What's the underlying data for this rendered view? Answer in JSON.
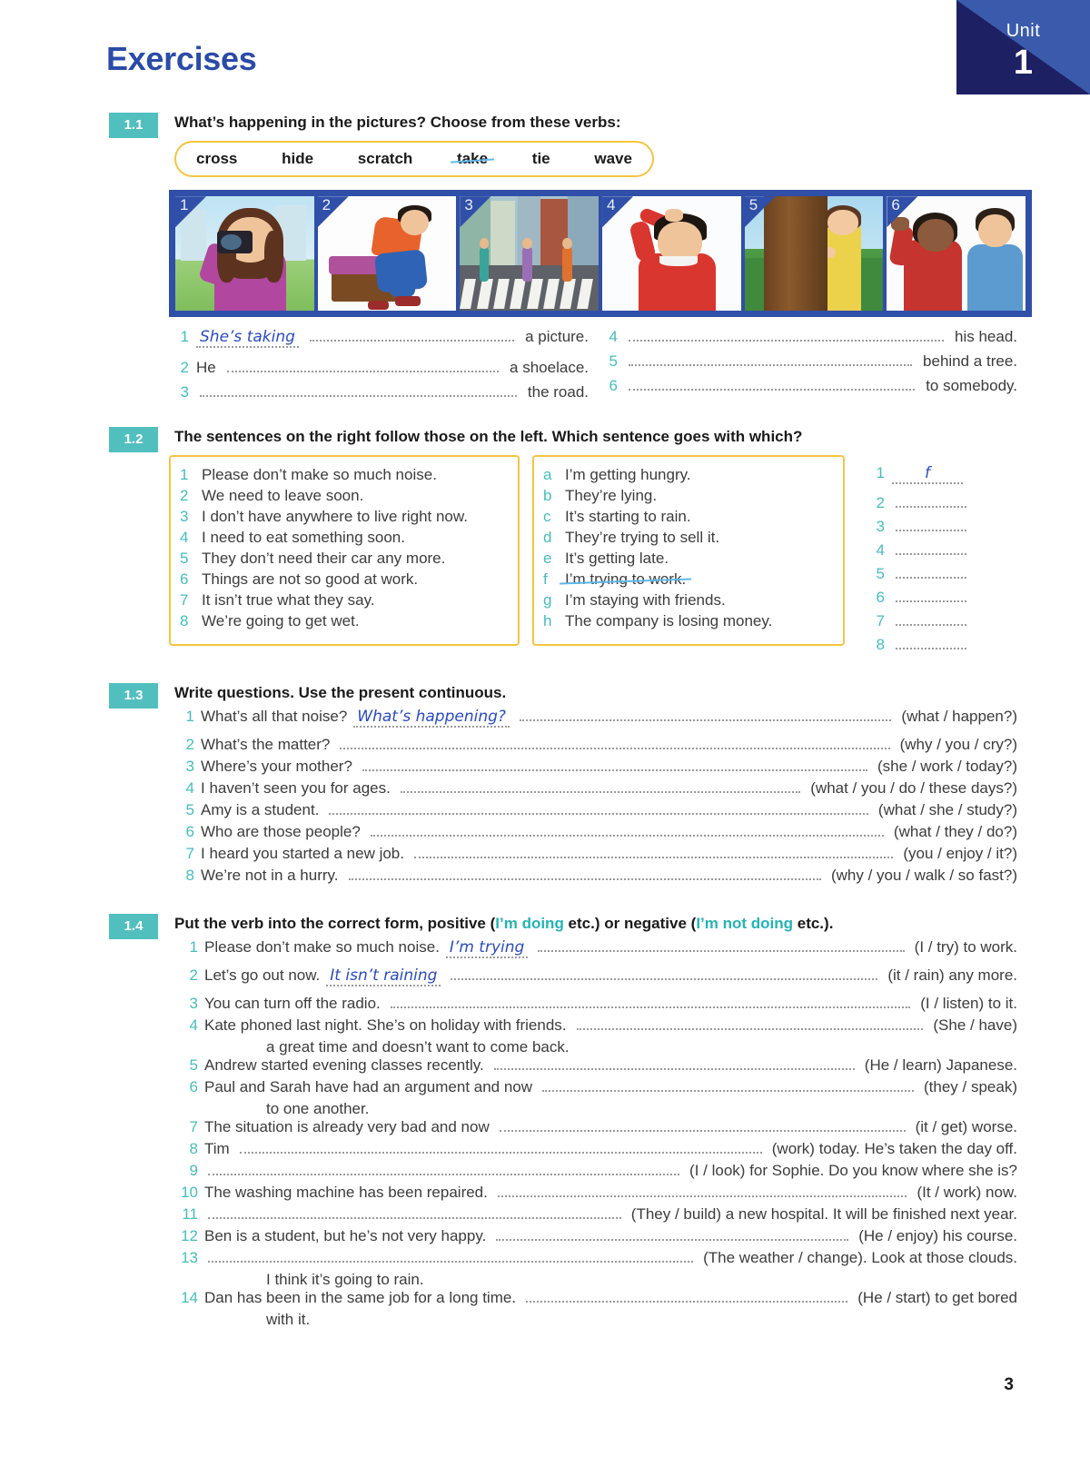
{
  "unit": {
    "label": "Unit",
    "number": "1"
  },
  "page_title": "Exercises",
  "page_number": "3",
  "ex11": {
    "number": "1.1",
    "heading": "What’s happening in the pictures?  Choose from these verbs:",
    "verbs": [
      "cross",
      "hide",
      "scratch",
      "take",
      "tie",
      "wave"
    ],
    "struck_verb": "take",
    "pictures": [
      {
        "num": "1",
        "desc": "woman-taking-photo"
      },
      {
        "num": "2",
        "desc": "man-tying-shoelace"
      },
      {
        "num": "3",
        "desc": "people-crossing-road"
      },
      {
        "num": "4",
        "desc": "man-scratching-head"
      },
      {
        "num": "5",
        "desc": "girl-hiding-behind-tree"
      },
      {
        "num": "6",
        "desc": "woman-waving"
      }
    ],
    "answers_left": [
      {
        "n": "1",
        "before": "",
        "answer": "She’s taking",
        "after": "a picture."
      },
      {
        "n": "2",
        "before": "He",
        "answer": "",
        "after": "a shoelace."
      },
      {
        "n": "3",
        "before": "",
        "answer": "",
        "after": "the road."
      }
    ],
    "answers_right": [
      {
        "n": "4",
        "before": "",
        "answer": "",
        "after": "his head."
      },
      {
        "n": "5",
        "before": "",
        "answer": "",
        "after": "behind a tree."
      },
      {
        "n": "6",
        "before": "",
        "answer": "",
        "after": "to somebody."
      }
    ]
  },
  "ex12": {
    "number": "1.2",
    "heading": "The sentences on the right follow those on the left.  Which sentence goes with which?",
    "left": [
      {
        "n": "1",
        "text": "Please don’t make so much noise."
      },
      {
        "n": "2",
        "text": "We need to leave soon."
      },
      {
        "n": "3",
        "text": "I don’t have anywhere to live right now."
      },
      {
        "n": "4",
        "text": "I need to eat something soon."
      },
      {
        "n": "5",
        "text": "They don’t need their car any more."
      },
      {
        "n": "6",
        "text": "Things are not so good at work."
      },
      {
        "n": "7",
        "text": "It isn’t true what they say."
      },
      {
        "n": "8",
        "text": "We’re going to get wet."
      }
    ],
    "right": [
      {
        "n": "a",
        "text": "I’m getting hungry.",
        "struck": false
      },
      {
        "n": "b",
        "text": "They’re lying.",
        "struck": false
      },
      {
        "n": "c",
        "text": "It’s starting to rain.",
        "struck": false
      },
      {
        "n": "d",
        "text": "They’re trying to sell it.",
        "struck": false
      },
      {
        "n": "e",
        "text": "It’s getting late.",
        "struck": false
      },
      {
        "n": "f",
        "text": "I’m trying to work.",
        "struck": true
      },
      {
        "n": "g",
        "text": "I’m staying with friends.",
        "struck": false
      },
      {
        "n": "h",
        "text": "The company is losing money.",
        "struck": false
      }
    ],
    "answers": [
      {
        "n": "1",
        "answer": "f"
      },
      {
        "n": "2",
        "answer": ""
      },
      {
        "n": "3",
        "answer": ""
      },
      {
        "n": "4",
        "answer": ""
      },
      {
        "n": "5",
        "answer": ""
      },
      {
        "n": "6",
        "answer": ""
      },
      {
        "n": "7",
        "answer": ""
      },
      {
        "n": "8",
        "answer": ""
      }
    ]
  },
  "ex13": {
    "number": "1.3",
    "heading": "Write questions.  Use the present continuous.",
    "items": [
      {
        "n": "1",
        "prompt": "What’s all that noise?",
        "answer": "What’s happening?",
        "cue": "(what / happen?)"
      },
      {
        "n": "2",
        "prompt": "What’s the matter?",
        "answer": "",
        "cue": "(why / you / cry?)"
      },
      {
        "n": "3",
        "prompt": "Where’s your mother?",
        "answer": "",
        "cue": "(she / work / today?)"
      },
      {
        "n": "4",
        "prompt": "I haven’t seen you for ages.",
        "answer": "",
        "cue": "(what / you / do / these days?)"
      },
      {
        "n": "5",
        "prompt": "Amy is a student.",
        "answer": "",
        "cue": "(what / she / study?)"
      },
      {
        "n": "6",
        "prompt": "Who are those people?",
        "answer": "",
        "cue": "(what / they / do?)"
      },
      {
        "n": "7",
        "prompt": "I heard you started a new job.",
        "answer": "",
        "cue": "(you / enjoy / it?)"
      },
      {
        "n": "8",
        "prompt": "We’re not in a hurry.",
        "answer": "",
        "cue": "(why / you / walk / so fast?)"
      }
    ]
  },
  "ex14": {
    "number": "1.4",
    "heading_part1": "Put the verb into the correct form, positive (",
    "heading_pos": "I’m doing",
    "heading_part2": " etc.) or negative (",
    "heading_neg": "I’m not doing",
    "heading_part3": " etc.).",
    "items": [
      {
        "n": "1",
        "prompt": "Please don’t make so much noise.",
        "answer": "I’m trying",
        "cue": "(I / try) to work.",
        "cont": ""
      },
      {
        "n": "2",
        "prompt": "Let’s go out now.",
        "answer": "It isn’t raining",
        "cue": "(it / rain) any more.",
        "cont": ""
      },
      {
        "n": "3",
        "prompt": "You can turn off the radio.",
        "answer": "",
        "cue": "(I / listen) to it.",
        "cont": ""
      },
      {
        "n": "4",
        "prompt": "Kate phoned last night.  She’s on holiday with friends.",
        "answer": "",
        "cue": "(She / have)",
        "cont": "a great time and doesn’t want to come back."
      },
      {
        "n": "5",
        "prompt": "Andrew started evening classes recently.",
        "answer": "",
        "cue": "(He / learn) Japanese.",
        "cont": ""
      },
      {
        "n": "6",
        "prompt": "Paul and Sarah have had an argument and now",
        "answer": "",
        "cue": "(they / speak)",
        "cont": "to one another."
      },
      {
        "n": "7",
        "prompt": "The situation is already very bad and now",
        "answer": "",
        "cue": "(it / get) worse.",
        "cont": ""
      },
      {
        "n": "8",
        "prompt": "Tim",
        "answer": "",
        "cue": "(work) today.  He’s taken the day off.",
        "cont": ""
      },
      {
        "n": "9",
        "prompt": "",
        "answer": "",
        "cue": "(I / look) for Sophie.  Do you know where she is?",
        "cont": ""
      },
      {
        "n": "10",
        "prompt": "The washing machine has been repaired.",
        "answer": "",
        "cue": "(It / work) now.",
        "cont": ""
      },
      {
        "n": "11",
        "prompt": "",
        "answer": "",
        "cue": "(They / build) a new hospital.  It will be finished next year.",
        "cont": ""
      },
      {
        "n": "12",
        "prompt": "Ben is a student, but he’s not very happy.",
        "answer": "",
        "cue": "(He / enjoy) his course.",
        "cont": ""
      },
      {
        "n": "13",
        "prompt": "",
        "answer": "",
        "cue": "(The weather / change).  Look at those clouds.",
        "cont": "I think it’s going to rain."
      },
      {
        "n": "14",
        "prompt": "Dan has been in the same job for a long time.",
        "answer": "",
        "cue": "(He / start) to get bored",
        "cont": "with it."
      }
    ]
  },
  "colors": {
    "title_blue": "#2b4ba8",
    "badge_teal": "#52bfbf",
    "number_teal": "#45bdbd",
    "box_gold": "#f5c441",
    "handwriting_blue": "#2a4bc0",
    "strike_blue": "#5fb8e8",
    "unit_dark": "#1e2064",
    "unit_light": "#3a5bab",
    "frame_blue": "#2f4fa8"
  }
}
